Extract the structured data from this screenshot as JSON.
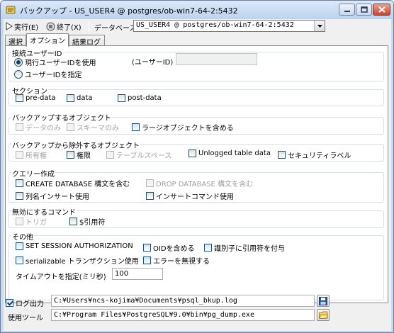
{
  "window": {
    "title": "バックアップ - US_USER4 @ postgres/ob-win7-64-2:5432"
  },
  "toolbar": {
    "execute_label": "実行(E)",
    "quit_label": "終了(X)",
    "database_label": "データベース",
    "database_value": "US_USER4 @ postgres/ob-win7-64-2:5432"
  },
  "tabs": [
    {
      "label": "選択"
    },
    {
      "label": "オプション"
    },
    {
      "label": "結果ログ"
    }
  ],
  "connection": {
    "title": "接続ユーザーID",
    "radio_current": "現行ユーザーIDを使用",
    "radio_specify": "ユーザーIDを指定",
    "userid_label": "(ユーザーID)",
    "userid_value": ""
  },
  "section": {
    "title": "セクション",
    "items": [
      {
        "label": "pre-data",
        "checked": false
      },
      {
        "label": "data",
        "checked": false
      },
      {
        "label": "post-data",
        "checked": false
      }
    ]
  },
  "backup_objects": {
    "title": "バックアップするオブジェクト",
    "items": [
      {
        "label": "データのみ",
        "checked": false,
        "disabled": true
      },
      {
        "label": "スキーマのみ",
        "checked": false,
        "disabled": true
      },
      {
        "label": "ラージオブジェクトを含める",
        "checked": false,
        "disabled": false
      }
    ]
  },
  "exclude_objects": {
    "title": "バックアップから除外するオブジェクト",
    "items": [
      {
        "label": "所有権",
        "checked": false,
        "disabled": true
      },
      {
        "label": "権限",
        "checked": false,
        "disabled": false
      },
      {
        "label": "テーブルスペース",
        "checked": false,
        "disabled": true
      },
      {
        "label": "Unlogged table data",
        "checked": false,
        "disabled": false
      },
      {
        "label": "セキュリティラベル",
        "checked": false,
        "disabled": false
      }
    ]
  },
  "query": {
    "title": "クエリー作成",
    "items": [
      {
        "label": "CREATE DATABASE 構文を含む",
        "checked": false,
        "disabled": false
      },
      {
        "label": "DROP DATABASE 構文を含む",
        "checked": false,
        "disabled": true
      },
      {
        "label": "列名インサート使用",
        "checked": false,
        "disabled": false
      },
      {
        "label": "インサートコマンド使用",
        "checked": false,
        "disabled": false
      }
    ]
  },
  "disable_commands": {
    "title": "無効にするコマンド",
    "items": [
      {
        "label": "トリガ",
        "checked": false,
        "disabled": true
      },
      {
        "label": "$引用符",
        "checked": false,
        "disabled": false
      }
    ]
  },
  "other": {
    "title": "その他",
    "items": [
      {
        "label": "SET SESSION AUTHORIZATION",
        "checked": false
      },
      {
        "label": "OIDを含める",
        "checked": false
      },
      {
        "label": "識別子に引用符を付与",
        "checked": false
      },
      {
        "label": "serializable トランザクション使用",
        "checked": false
      },
      {
        "label": "エラーを無視する",
        "checked": false
      }
    ],
    "timeout_label": "タイムアウトを指定(ミリ秒)",
    "timeout_value": "100"
  },
  "footer": {
    "log_output_label": "ログ出力",
    "log_output_checked": true,
    "log_path": "C:¥Users¥ncs-kojima¥Documents¥psql_bkup.log",
    "tool_label": "使用ツール",
    "tool_path": "C:¥Program Files¥PostgreSQL¥9.0¥bin¥pg_dump.exe"
  },
  "colors": {
    "titlebar": "#bcd2ee",
    "client": "#f0f0f0",
    "checkbox_border": "#1c5180",
    "group_border": "#d5dfe5",
    "disabled_text": "#a0a0a0"
  },
  "icons": [
    "app-icon",
    "minimize-icon",
    "maximize-icon",
    "close-icon",
    "play-icon",
    "stop-icon",
    "dropdown-arrow-icon",
    "save-icon",
    "folder-icon"
  ]
}
